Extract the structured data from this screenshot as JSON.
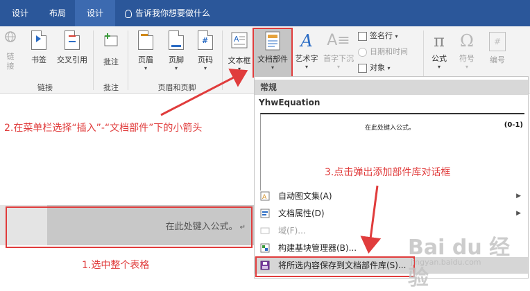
{
  "tabs": [
    {
      "label": "设计",
      "active": false
    },
    {
      "label": "布局",
      "active": false
    },
    {
      "label": "设计",
      "active": true
    }
  ],
  "tell_me": "告诉我你想要做什么",
  "ribbon": {
    "links_group": {
      "label": "链接",
      "buttons": {
        "link": "链\n接",
        "bookmark": "书签",
        "crossref": "交叉引用"
      }
    },
    "comments_group": {
      "label": "批注",
      "buttons": {
        "comment": "批注"
      }
    },
    "header_footer_group": {
      "label": "页眉和页脚",
      "buttons": {
        "header": "页眉",
        "footer": "页脚",
        "page_number": "页码"
      }
    },
    "text_group": {
      "textbox": "文本框",
      "quick_parts": "文档部件",
      "wordart": "艺术字",
      "dropcap": "首字下沉",
      "signature": "签名行",
      "datetime": "日期和时间",
      "object": "对象"
    },
    "symbols_group": {
      "equation": "公式",
      "symbol": "符号",
      "number": "编号"
    }
  },
  "dropdown": {
    "section": "常规",
    "entry_name": "YhwEquation",
    "preview_text": "在此处键入公式。",
    "preview_number": "(0-1)",
    "items": [
      {
        "label": "自动图文集(A)",
        "submenu": true,
        "disabled": false
      },
      {
        "label": "文档属性(D)",
        "submenu": true,
        "disabled": false
      },
      {
        "label": "域(F)...",
        "submenu": false,
        "disabled": true
      },
      {
        "label": "构建基块管理器(B)...",
        "submenu": false,
        "disabled": false
      },
      {
        "label": "将所选内容保存到文档部件库(S)...",
        "submenu": false,
        "disabled": false
      }
    ]
  },
  "document": {
    "placeholder": "在此处键入公式。"
  },
  "annotations": {
    "step1": "1.选中整个表格",
    "step2": "2.在菜单栏选择“插入”-“文档部件”下的小箭头",
    "step3": "3.点击弹出添加部件库对话框"
  },
  "watermark": {
    "brand": "Bai du 经验",
    "url": "jingyan.baidu.com"
  },
  "colors": {
    "titlebar": "#2b579a",
    "annotation_red": "#e03c3c",
    "ribbon_bg": "#f3f3f3"
  }
}
